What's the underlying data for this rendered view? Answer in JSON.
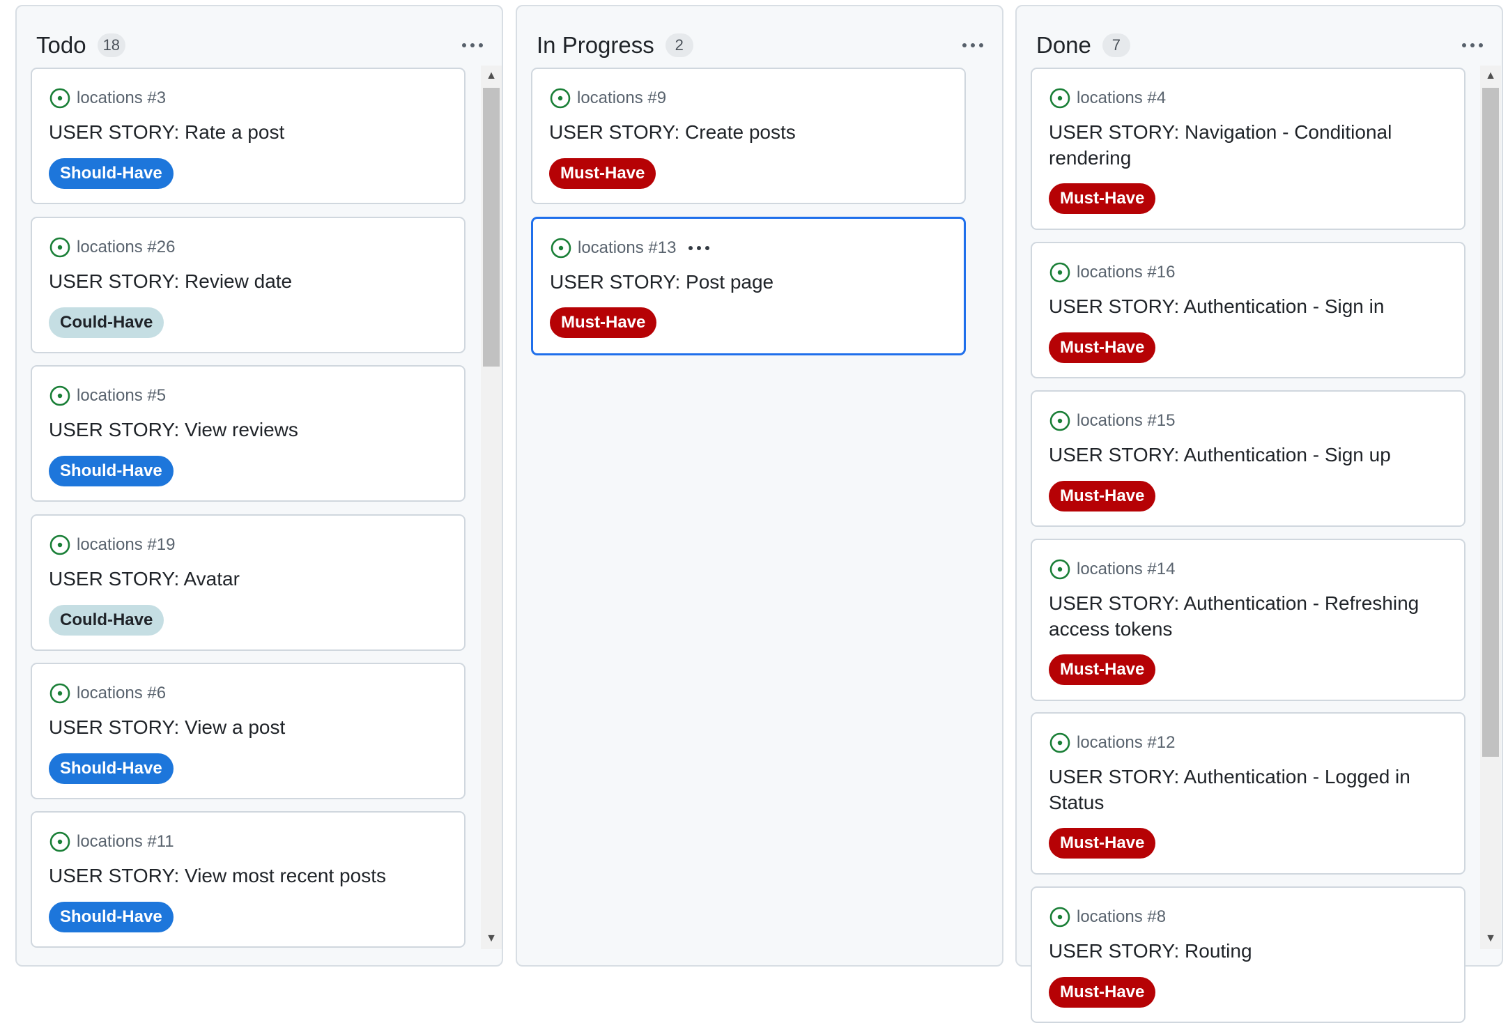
{
  "columns": [
    {
      "title": "Todo",
      "count": "18",
      "cards": [
        {
          "ref": "locations #3",
          "title": "USER STORY: Rate a post",
          "label": "Should-Have"
        },
        {
          "ref": "locations #26",
          "title": "USER STORY: Review date",
          "label": "Could-Have"
        },
        {
          "ref": "locations #5",
          "title": "USER STORY: View reviews",
          "label": "Should-Have"
        },
        {
          "ref": "locations #19",
          "title": "USER STORY: Avatar",
          "label": "Could-Have"
        },
        {
          "ref": "locations #6",
          "title": "USER STORY: View a post",
          "label": "Should-Have"
        },
        {
          "ref": "locations #11",
          "title": "USER STORY: View most recent posts",
          "label": "Should-Have"
        }
      ]
    },
    {
      "title": "In Progress",
      "count": "2",
      "cards": [
        {
          "ref": "locations #9",
          "title": "USER STORY: Create posts",
          "label": "Must-Have"
        },
        {
          "ref": "locations #13",
          "title": "USER STORY: Post page",
          "label": "Must-Have"
        }
      ]
    },
    {
      "title": "Done",
      "count": "7",
      "cards": [
        {
          "ref": "locations #4",
          "title": "USER STORY: Navigation - Conditional rendering",
          "label": "Must-Have"
        },
        {
          "ref": "locations #16",
          "title": "USER STORY: Authentication - Sign in",
          "label": "Must-Have"
        },
        {
          "ref": "locations #15",
          "title": "USER STORY: Authentication - Sign up",
          "label": "Must-Have"
        },
        {
          "ref": "locations #14",
          "title": "USER STORY: Authentication - Refreshing access tokens",
          "label": "Must-Have"
        },
        {
          "ref": "locations #12",
          "title": "USER STORY: Authentication - Logged in Status",
          "label": "Must-Have"
        },
        {
          "ref": "locations #8",
          "title": "USER STORY: Routing",
          "label": "Must-Have"
        }
      ]
    }
  ],
  "colors": {
    "should_have": "#1d76db",
    "could_have": "#c5dee3",
    "must_have": "#b60205",
    "open_issue_icon": "#1a7f37",
    "selected_border": "#1f6feb"
  },
  "icons": {
    "card_status": "issue-opened-icon",
    "column_menu": "kebab-horizontal-icon",
    "scroll_up": "scroll-up-arrow-icon",
    "scroll_down": "scroll-down-arrow-icon"
  }
}
